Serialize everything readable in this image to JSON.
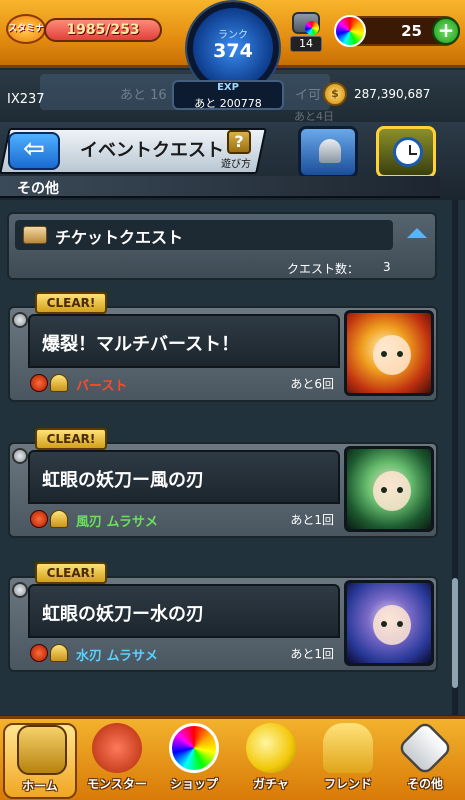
{
  "top_bar": {
    "stamina_label": "スタミナ",
    "stamina_value": "1985/253",
    "stamina_fill": 1.0,
    "rank_label": "ランク",
    "rank_value": "374",
    "exp_label": "EXP",
    "exp_remaining": "あと 200778",
    "box_count": "14",
    "orb_count": "25",
    "orb_plus": "+"
  },
  "info_row": {
    "player_id": "IX237",
    "faded_text_1": "あと 16",
    "faded_text_2": "イ可",
    "faded_text_3": "あと4日",
    "coin_symbol": "$",
    "coins": "287,390,687"
  },
  "header": {
    "back_arrow": "⇦",
    "title": "イベントクエスト",
    "help_symbol": "?",
    "help_label": "遊び方",
    "category": "その他"
  },
  "ticket_panel": {
    "title": "チケットクエスト",
    "quest_count_label": "クエスト数：",
    "quest_count_value": "3"
  },
  "quests": [
    {
      "badge": "CLEAR!",
      "name": "爆裂！マルチバースト！",
      "monster": "バースト",
      "monster_color": "#ff4a2a",
      "remaining": "あと6回"
    },
    {
      "badge": "CLEAR!",
      "name": "虹眼の妖刀ー風の刃",
      "monster": "風刃 ムラサメ",
      "monster_color": "#6be05a",
      "remaining": "あと1回"
    },
    {
      "badge": "CLEAR!",
      "name": "虹眼の妖刀ー水の刃",
      "monster": "水刃 ムラサメ",
      "monster_color": "#5ad0ff",
      "remaining": "あと1回"
    }
  ],
  "bottom_nav": [
    {
      "label": "ホーム",
      "icon": "home-gate-icon"
    },
    {
      "label": "モンスター",
      "icon": "dragon-icon"
    },
    {
      "label": "ショップ",
      "icon": "rainbow-orb-icon"
    },
    {
      "label": "ガチャ",
      "icon": "gacha-egg-icon"
    },
    {
      "label": "フレンド",
      "icon": "friends-icon"
    },
    {
      "label": "その他",
      "icon": "other-menu-icon"
    }
  ]
}
